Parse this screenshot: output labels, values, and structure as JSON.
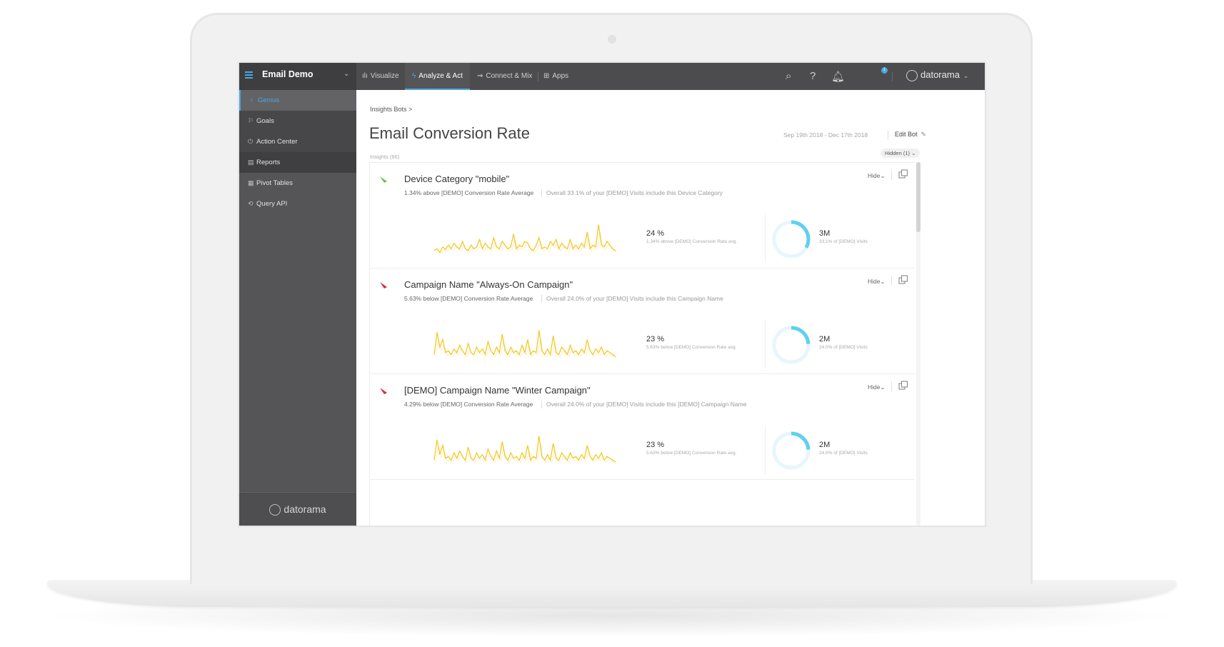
{
  "topbar": {
    "workspace": "Email Demo",
    "tabs": [
      {
        "label": "Visualize",
        "icon": "bar-chart-icon"
      },
      {
        "label": "Analyze & Act",
        "icon": "lightning-icon",
        "active": true
      },
      {
        "label": "Connect & Mix",
        "icon": "connect-icon"
      },
      {
        "label": "Apps",
        "icon": "grid-icon"
      }
    ],
    "notification_count": "1",
    "logo_text": "datorama"
  },
  "sidebar": {
    "items": [
      {
        "label": "Genius",
        "icon": "bulb-icon",
        "active": true
      },
      {
        "label": "Goals",
        "icon": "flag-icon"
      },
      {
        "label": "Action Center",
        "icon": "power-icon"
      },
      {
        "label": "Reports",
        "icon": "report-icon"
      },
      {
        "label": "Pivot Tables",
        "icon": "table-icon"
      },
      {
        "label": "Query API",
        "icon": "refresh-icon"
      }
    ],
    "footer_logo": "datorama"
  },
  "main": {
    "breadcrumb": "Insights Bots >",
    "title": "Email Conversion Rate",
    "date_range": "Sep 19th 2018 - Dec 17th 2018",
    "edit_label": "Edit Bot",
    "insights_count": "Insights (66)",
    "hidden_filter": "Hidden (1) ⌄",
    "cards": [
      {
        "trend": "up",
        "title": "Device Category \"mobile\"",
        "subtitle": "1.34% above [DEMO] Conversion Rate Average",
        "overall": "Overall 33.1% of your [DEMO] Visits include this Device Category",
        "hide_label": "Hide⌄",
        "metric_value": "24 %",
        "metric_caption": "1.34% above [DEMO] Conversion Rate avg.",
        "donut_value": "3M",
        "donut_caption": "33.1% of [DEMO] Visits",
        "donut_fraction": 0.331,
        "sparkline": [
          0.25,
          0.3,
          0.2,
          0.35,
          0.28,
          0.4,
          0.3,
          0.45,
          0.35,
          0.3,
          0.5,
          0.3,
          0.25,
          0.4,
          0.3,
          0.35,
          0.55,
          0.3,
          0.45,
          0.35,
          0.3,
          0.6,
          0.35,
          0.3,
          0.5,
          0.4,
          0.3,
          0.35,
          0.7,
          0.3,
          0.4,
          0.35,
          0.5,
          0.45,
          0.3,
          0.25,
          0.4,
          0.6,
          0.3,
          0.35,
          0.3,
          0.5,
          0.4,
          0.55,
          0.3,
          0.45,
          0.35,
          0.3,
          0.55,
          0.3,
          0.4,
          0.3,
          0.45,
          0.35,
          0.75,
          0.3,
          0.4,
          0.35,
          0.95,
          0.4,
          0.35,
          0.5,
          0.4,
          0.3,
          0.25
        ]
      },
      {
        "trend": "down",
        "title": "Campaign Name \"Always-On Campaign\"",
        "subtitle": "5.63% below [DEMO] Conversion Rate Average",
        "overall": "Overall 24.0% of your [DEMO] Visits include this Campaign Name",
        "hide_label": "Hide⌄",
        "metric_value": "23 %",
        "metric_caption": "5.63% below [DEMO] Conversion Rate avg.",
        "donut_value": "2M",
        "donut_caption": "24.0% of [DEMO] Visits",
        "donut_fraction": 0.24,
        "sparkline": [
          0.3,
          0.9,
          0.5,
          0.7,
          0.35,
          0.4,
          0.3,
          0.45,
          0.35,
          0.55,
          0.4,
          0.3,
          0.6,
          0.35,
          0.3,
          0.5,
          0.35,
          0.45,
          0.3,
          0.65,
          0.4,
          0.3,
          0.5,
          0.35,
          0.85,
          0.4,
          0.3,
          0.5,
          0.35,
          0.4,
          0.3,
          0.55,
          0.35,
          0.7,
          0.3,
          0.4,
          0.35,
          0.95,
          0.4,
          0.3,
          0.45,
          0.3,
          0.8,
          0.35,
          0.3,
          0.5,
          0.4,
          0.3,
          0.55,
          0.35,
          0.4,
          0.3,
          0.45,
          0.35,
          0.7,
          0.4,
          0.3,
          0.45,
          0.35,
          0.5,
          0.3,
          0.4,
          0.35,
          0.3,
          0.25
        ]
      },
      {
        "trend": "down",
        "title": "[DEMO] Campaign Name \"Winter Campaign\"",
        "subtitle": "4.29% below [DEMO] Conversion Rate Average",
        "overall": "Overall 24.0% of your [DEMO] Visits include this [DEMO] Campaign Name",
        "hide_label": "Hide⌄",
        "metric_value": "23 %",
        "metric_caption": "5.63% below [DEMO] Conversion Rate avg.",
        "donut_value": "2M",
        "donut_caption": "24.0% of [DEMO] Visits",
        "donut_fraction": 0.24,
        "sparkline": [
          0.3,
          0.85,
          0.45,
          0.7,
          0.35,
          0.4,
          0.3,
          0.5,
          0.35,
          0.55,
          0.4,
          0.3,
          0.65,
          0.35,
          0.3,
          0.5,
          0.35,
          0.45,
          0.3,
          0.6,
          0.4,
          0.3,
          0.55,
          0.35,
          0.8,
          0.4,
          0.3,
          0.5,
          0.35,
          0.4,
          0.3,
          0.5,
          0.35,
          0.7,
          0.3,
          0.4,
          0.35,
          0.95,
          0.4,
          0.3,
          0.45,
          0.3,
          0.75,
          0.35,
          0.3,
          0.5,
          0.4,
          0.3,
          0.5,
          0.35,
          0.4,
          0.3,
          0.45,
          0.35,
          0.7,
          0.4,
          0.3,
          0.45,
          0.35,
          0.5,
          0.3,
          0.4,
          0.35,
          0.3,
          0.25
        ]
      }
    ]
  },
  "colors": {
    "accent": "#4aa8e0",
    "sparkline": "#f5c518",
    "trend_up": "#6cc04a",
    "trend_down": "#e2263a",
    "donut": "#5fd0f0"
  }
}
